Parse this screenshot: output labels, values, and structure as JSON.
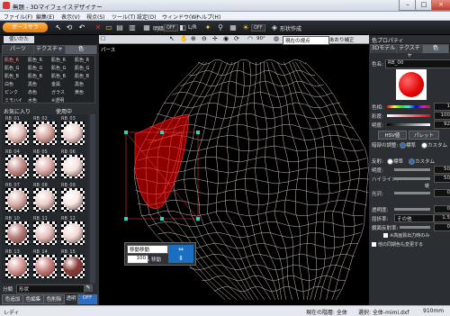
{
  "window": {
    "title": "無題 - 3Dマイフェイスデザイナー",
    "buttons": [
      "–",
      "□",
      "×"
    ]
  },
  "menu": [
    "ファイル(F)",
    "編集(E)",
    "表示(V)",
    "視点(S)",
    "ツール(T)",
    "設定(O)",
    "ウィンドウ(W)",
    "ヘルプ(H)"
  ],
  "toolbar": {
    "title_button": "ポースサラ",
    "shading": "明暗",
    "shading_state": "OFF",
    "lr_label": "L/R",
    "preview_label": "形状作成"
  },
  "left_panel": {
    "top_tabs": [
      "使いかた",
      "全体"
    ],
    "sub_tabs": [
      "パーツ",
      "テクスチャ",
      "色"
    ],
    "palette": [
      [
        "肌色_R",
        "肌色_R",
        "肌色_R",
        "肌色_R"
      ],
      [
        "肌色_G",
        "肌色_G",
        "肌色_G",
        "肌色_G"
      ],
      [
        "肌色_B",
        "肌色_B",
        "肌色_B",
        "肌色_B"
      ],
      [
        "白色",
        "黒色",
        "金属",
        "黒色"
      ],
      [
        "ピンク",
        "赤色",
        "ガラス",
        "黄色"
      ],
      [
        "ミモハイ",
        "水色",
        "※透明",
        ""
      ]
    ],
    "favorites_label": "お気に入り",
    "used_label": "使用中",
    "materials": [
      "RB_01",
      "RB_02",
      "RB_03",
      "RB_04",
      "RB_05",
      "RB_06",
      "RB_07",
      "RB_08",
      "RB_09",
      "RB_10",
      "RB_11",
      "RB_12",
      "RB_13",
      "RB_14",
      "RB_15"
    ],
    "bottom_field_label": "分類",
    "bottom_field_value": "形状",
    "bottom_buttons": [
      "色追加",
      "色編集",
      "色削除",
      "透明",
      "OFF"
    ]
  },
  "viewport": {
    "toolbar_label": "パース",
    "zoom": "90°",
    "view_select": "現在の視点",
    "mirror_label": "あおり補正",
    "tool_panel": {
      "label": "移動移動",
      "value": "100",
      "unit": "% 移動"
    }
  },
  "properties": {
    "title": "色プロパティ",
    "tabs": [
      "3Dモデル",
      "テクスチャ",
      "色"
    ],
    "color_name_label": "色名:",
    "color_name": "RB_00",
    "hue_label": "色相:",
    "hue_value": "1",
    "sat_label": "彩度:",
    "sat_value": "100",
    "bri_label": "明度:",
    "bri_value": "92",
    "hsv_button": "HSV値",
    "palette_button": "パレット",
    "gloss_label": "暗部の調整:",
    "gloss_options": [
      "標準",
      "カスタム"
    ],
    "reflect_label": "反射:",
    "reflect_options": [
      "標準",
      "カスタム"
    ],
    "brightness_label": "明度:",
    "brightness_value": "50",
    "highlight_label": "ハイライト:",
    "highlight_value": "50",
    "highlight_extra": "暖",
    "glow_label": "光沢:",
    "glow_value": "0",
    "transparency_label": "透明度:",
    "transparency_value": "0",
    "refraction_label": "屈折率:",
    "refraction_select": "その他",
    "refraction_value": "1.5",
    "mirror_label": "鏡面反射率:",
    "mirror_value": "0",
    "checkbox1": "※高画質出力時のみ",
    "checkbox2": "他の同期色も変更する"
  },
  "status": {
    "left": "レディ",
    "right": "現在の階層: 全体",
    "path": "選択: 全体-mimi.dxf",
    "size": "910mm"
  }
}
